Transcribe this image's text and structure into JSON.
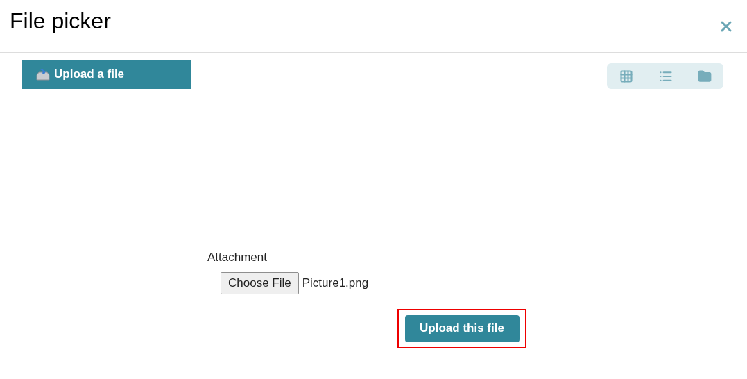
{
  "dialog": {
    "title": "File picker"
  },
  "repository": {
    "label": "Upload a file",
    "selected": true
  },
  "view_modes": [
    {
      "kind": "grid"
    },
    {
      "kind": "list"
    },
    {
      "kind": "folder"
    }
  ],
  "form": {
    "attachment_label": "Attachment",
    "choose_button": "Choose File",
    "file_name": "Picture1.png",
    "submit": {
      "label": "Upload this file",
      "highlighted": true
    }
  }
}
